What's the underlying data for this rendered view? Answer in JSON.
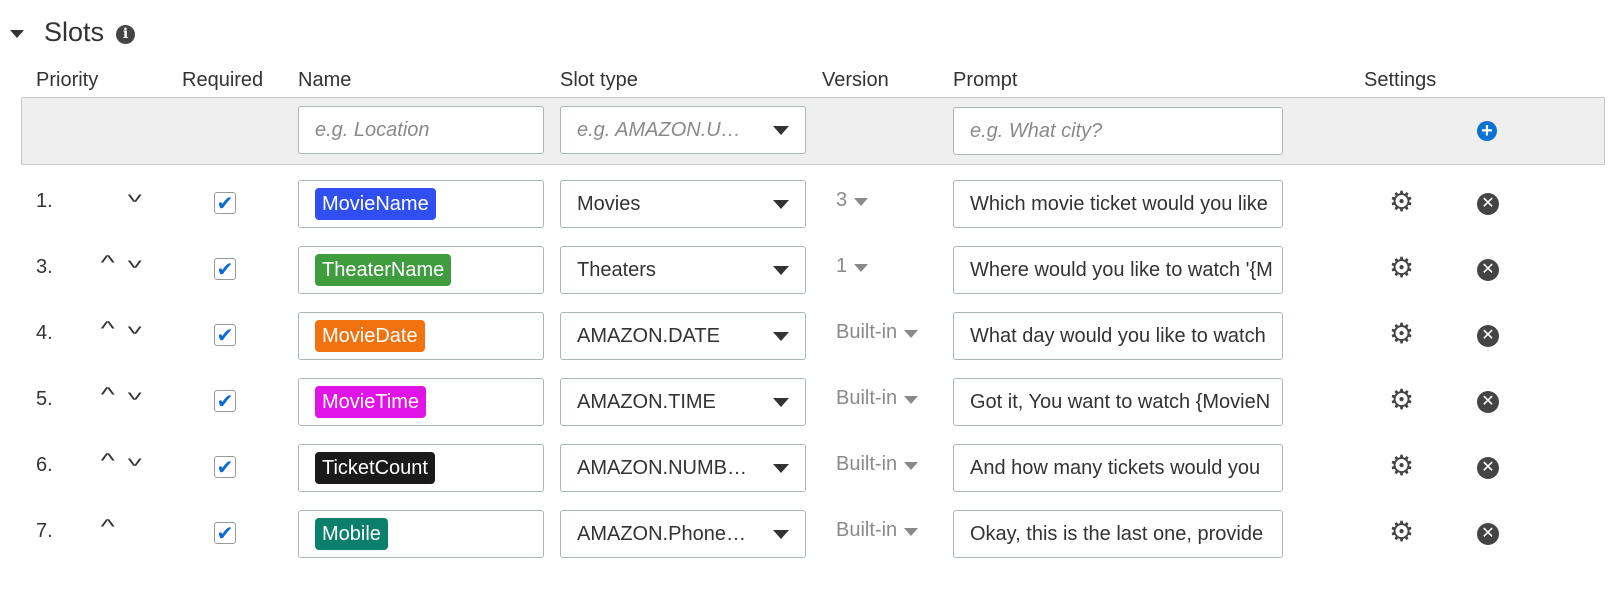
{
  "section": {
    "title": "Slots"
  },
  "columns": {
    "priority": "Priority",
    "required": "Required",
    "name": "Name",
    "slot_type": "Slot type",
    "version": "Version",
    "prompt": "Prompt",
    "settings": "Settings"
  },
  "new_slot": {
    "name_placeholder": "e.g. Location",
    "type_placeholder": "e.g. AMAZON.U…",
    "prompt_placeholder": "e.g. What city?"
  },
  "slots": [
    {
      "priority": "1.",
      "up": false,
      "down": true,
      "required": true,
      "name": "MovieName",
      "color": "#2f4ff0",
      "type": "Movies",
      "version": "3",
      "prompt": "Which movie ticket would you like"
    },
    {
      "priority": "3.",
      "up": true,
      "down": true,
      "required": true,
      "name": "TheaterName",
      "color": "#3f9c3f",
      "type": "Theaters",
      "version": "1",
      "prompt": "Where would you like to watch '{M"
    },
    {
      "priority": "4.",
      "up": true,
      "down": true,
      "required": true,
      "name": "MovieDate",
      "color": "#f07310",
      "type": "AMAZON.DATE",
      "version": "Built-in",
      "prompt": "What day would you like to watch"
    },
    {
      "priority": "5.",
      "up": true,
      "down": true,
      "required": true,
      "name": "MovieTime",
      "color": "#e014e6",
      "type": "AMAZON.TIME",
      "version": "Built-in",
      "prompt": "Got it, You want to watch {MovieN"
    },
    {
      "priority": "6.",
      "up": true,
      "down": true,
      "required": true,
      "name": "TicketCount",
      "color": "#1a1a1a",
      "type": "AMAZON.NUMB…",
      "version": "Built-in",
      "prompt": "And how many tickets would you"
    },
    {
      "priority": "7.",
      "up": true,
      "down": false,
      "required": true,
      "name": "Mobile",
      "color": "#0a7f6c",
      "type": "AMAZON.Phone…",
      "version": "Built-in",
      "prompt": "Okay, this is the last one, provide"
    }
  ],
  "icons": {
    "collapse": "caret-down-icon",
    "info": "info-icon",
    "add": "plus-circle-icon",
    "settings": "gear-icon",
    "remove": "close-circle-icon",
    "move_up": "chevron-up-icon",
    "move_down": "chevron-down-icon"
  }
}
